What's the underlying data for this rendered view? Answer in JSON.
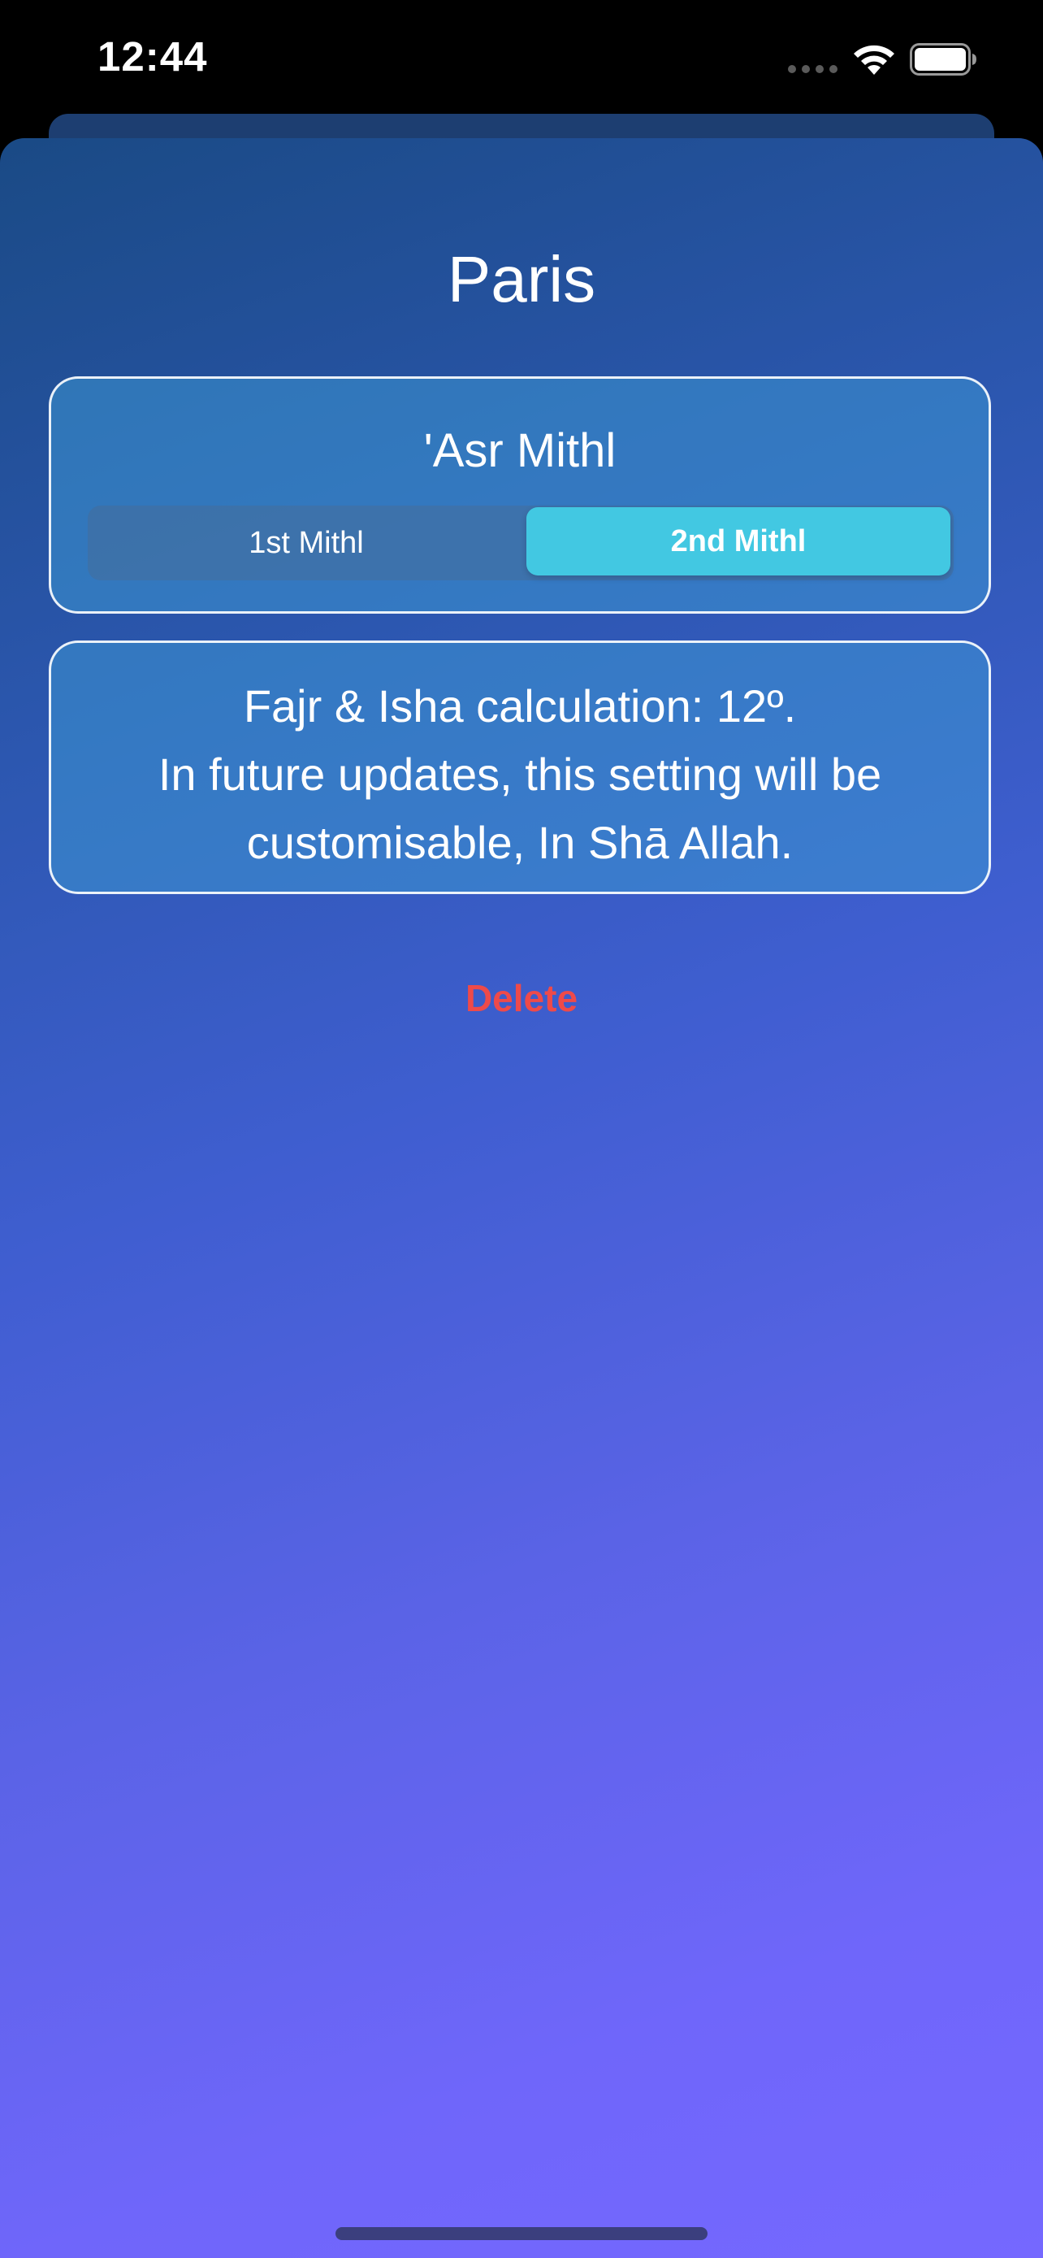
{
  "status_bar": {
    "time": "12:44",
    "icons": [
      "signal-dots-icon",
      "wifi-icon",
      "battery-icon"
    ]
  },
  "screen": {
    "title": "Paris"
  },
  "asr_card": {
    "title": "'Asr Mithl",
    "options": [
      "1st Mithl",
      "2nd Mithl"
    ],
    "selected": "2nd Mithl"
  },
  "info_card": {
    "lines": [
      "Fajr & Isha calculation: 12º.",
      "In future updates, this setting will be",
      "customisable, In Shā Allah."
    ]
  },
  "actions": {
    "delete_label": "Delete"
  },
  "colors": {
    "accent": "#42c8e2",
    "destructive": "#ee4a4a",
    "gradient_top": "#1a4a85",
    "gradient_bottom": "#7568ff"
  }
}
